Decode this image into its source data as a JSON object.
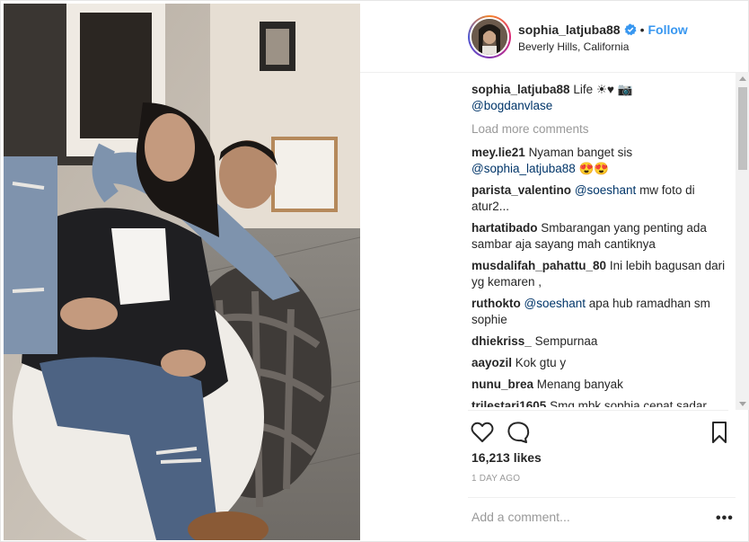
{
  "post": {
    "username": "sophia_latjuba88",
    "location": "Beverly Hills, California",
    "follow_label": "Follow",
    "dot": "•",
    "caption": {
      "user": "sophia_latjuba88",
      "text": "Life ☀♥ 📷",
      "mention": "@bogdanvlase"
    },
    "load_more": "Load more comments",
    "comments": [
      {
        "user": "mey.lie21",
        "text": "Nyaman banget sis ",
        "mention": "@sophia_latjuba88",
        "after": " 😍😍"
      },
      {
        "user": "parista_valentino",
        "text": "",
        "mention": "@soeshant",
        "after": " mw foto di atur2..."
      },
      {
        "user": "hartatibado",
        "text": "Smbarangan yang penting ada sambar aja sayang mah cantiknya",
        "mention": "",
        "after": ""
      },
      {
        "user": "musdalifah_pahattu_80",
        "text": "Ini lebih bagusan dari yg kemaren ,",
        "mention": "",
        "after": ""
      },
      {
        "user": "ruthokto",
        "text": "",
        "mention": "@soeshant",
        "after": " apa hub ramadhan sm sophie"
      },
      {
        "user": "dhiekriss_",
        "text": "Sempurnaa",
        "mention": "",
        "after": ""
      },
      {
        "user": "aayozil",
        "text": "Kok gtu y",
        "mention": "",
        "after": ""
      },
      {
        "user": "nunu_brea",
        "text": "Menang banyak",
        "mention": "",
        "after": ""
      },
      {
        "user": "trilestari1605",
        "text": "Smg mbk sophia cepat sadar",
        "mention": "",
        "after": ""
      }
    ],
    "likes": "16,213 likes",
    "time": "1 DAY AGO",
    "add_comment_placeholder": "Add a comment...",
    "more_label": "•••"
  },
  "icons": {
    "like": "heart-icon",
    "comment": "comment-bubble-icon",
    "save": "bookmark-icon",
    "verified": "verified-badge-icon",
    "more": "more-options-icon"
  },
  "colors": {
    "accent": "#3897f0",
    "mention": "#003569",
    "muted": "#999999"
  }
}
